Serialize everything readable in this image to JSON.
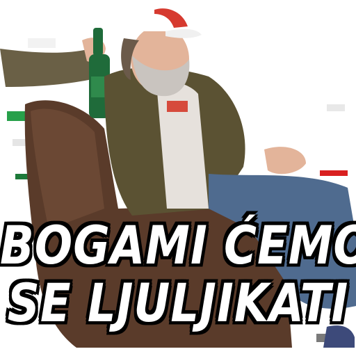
{
  "caption": {
    "line1": "BOGAMI ĆEMO",
    "line2": "SE LJULJIKATI"
  },
  "colors": {
    "caption_fill": "#ffffff",
    "caption_outline": "#000000",
    "armchair": "#5a3b2a",
    "jacket": "#5b5233",
    "jeans": "#4f6b8f",
    "cap": "#ffffff",
    "bottle": "#1f6b3a",
    "skin": "#e3b49a"
  }
}
